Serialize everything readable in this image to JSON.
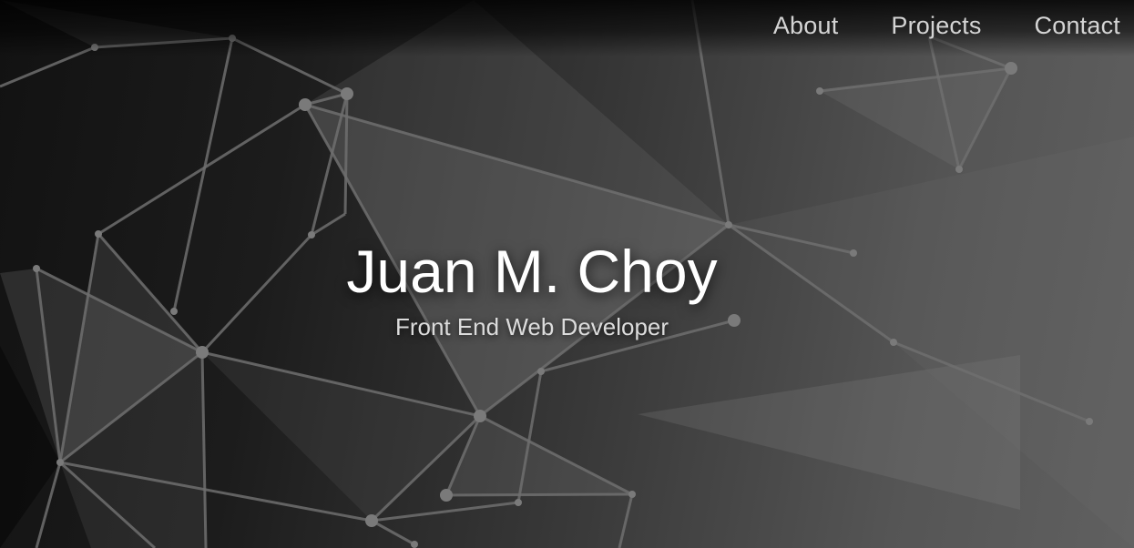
{
  "nav": {
    "items": [
      {
        "label": "About"
      },
      {
        "label": "Projects"
      },
      {
        "label": "Contact"
      }
    ]
  },
  "hero": {
    "name": "Juan M. Choy",
    "subtitle": "Front End Web Developer"
  },
  "background": {
    "style": "low-poly network pattern",
    "base_color": "#2a2a2a",
    "line_color": "#6e6e6e",
    "node_color": "#7a7a7a"
  }
}
